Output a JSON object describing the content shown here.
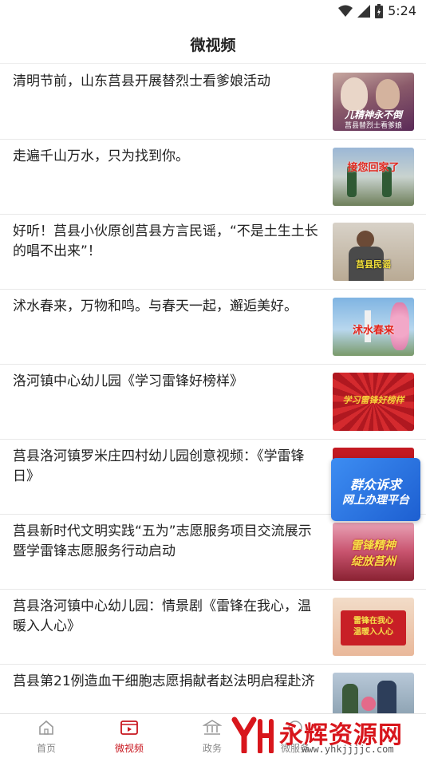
{
  "status": {
    "time": "5:24"
  },
  "header": {
    "title": "微视频"
  },
  "feed": [
    {
      "title": "清明节前，山东莒县开展替烈士看爹娘活动",
      "thumb_caption": "儿精神永不倒",
      "thumb_sub": "莒县替烈士看爹娘"
    },
    {
      "title": "走遍千山万水，只为找到你。",
      "thumb_caption": "接您回家了",
      "thumb_sub": ""
    },
    {
      "title": "好听！莒县小伙原创莒县方言民谣，“不是土生土长的唱不出来”！",
      "thumb_caption": "莒县民谣",
      "thumb_sub": ""
    },
    {
      "title": "沭水春来，万物和鸣。与春天一起，邂逅美好。",
      "thumb_caption": "沭水春来",
      "thumb_sub": ""
    },
    {
      "title": "洛河镇中心幼儿园《学习雷锋好榜样》",
      "thumb_caption": "学习雷锋好榜样",
      "thumb_sub": ""
    },
    {
      "title": "莒县洛河镇罗米庄四村幼儿园创意视频：《学雷锋日》",
      "thumb_caption": "",
      "thumb_sub": ""
    },
    {
      "title": "莒县新时代文明实践“五为”志愿服务项目交流展示暨学雷锋志愿服务行动启动",
      "thumb_caption": "雷锋精神",
      "thumb_sub": "绽放莒州"
    },
    {
      "title": "莒县洛河镇中心幼儿园：情景剧《雷锋在我心，温暖入人心》",
      "thumb_caption": "雷锋在我心",
      "thumb_sub": "温暖入人心"
    },
    {
      "title": "莒县第21例造血干细胞志愿捐献者赵法明启程赴济",
      "thumb_caption": "",
      "thumb_sub": ""
    }
  ],
  "float_banner": {
    "line1": "群众诉求",
    "line2": "网上办理平台"
  },
  "tabs": [
    {
      "label": "首页",
      "icon": "home-icon",
      "active": false
    },
    {
      "label": "微视频",
      "icon": "video-icon",
      "active": true
    },
    {
      "label": "政务",
      "icon": "government-icon",
      "active": false
    },
    {
      "label": "微服务",
      "icon": "service-icon",
      "active": false
    }
  ],
  "watermark": {
    "text": "永辉资源网",
    "url": "www.yhkjjjjc.com"
  },
  "colors": {
    "accent": "#c8161e",
    "banner": "#2f7de9"
  }
}
